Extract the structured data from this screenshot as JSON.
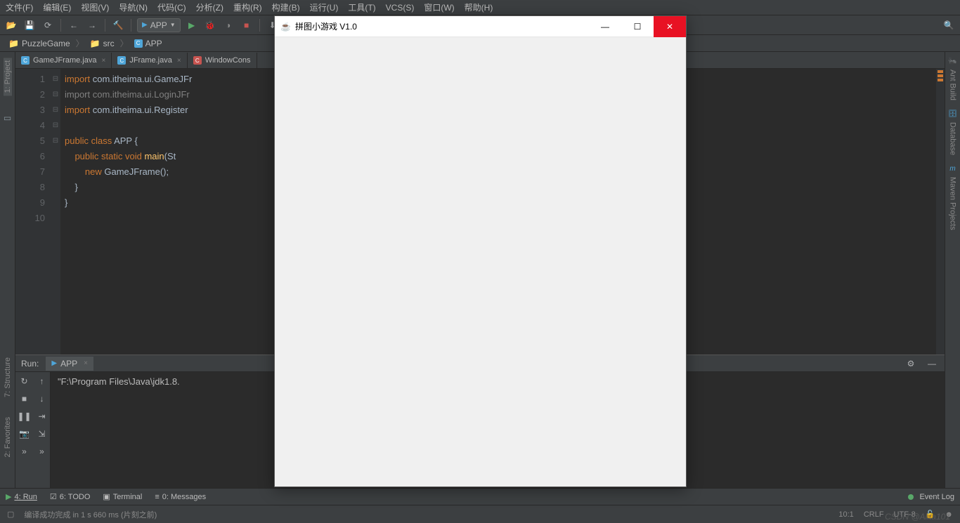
{
  "menu": {
    "file": "文件(F)",
    "edit": "编辑(E)",
    "view": "视图(V)",
    "nav": "导航(N)",
    "code": "代码(C)",
    "analyze": "分析(Z)",
    "refactor": "重构(R)",
    "build": "构建(B)",
    "run": "运行(U)",
    "tools": "工具(T)",
    "vcs": "VCS(S)",
    "window": "窗口(W)",
    "help": "帮助(H)"
  },
  "toolbar": {
    "run_config": "APP"
  },
  "breadcrumb": {
    "p0": "PuzzleGame",
    "p1": "src",
    "p2": "APP"
  },
  "left": {
    "project": "1: Project",
    "structure": "7: Structure",
    "fav": "2: Favorites"
  },
  "right": {
    "ant": "Ant Build",
    "db": "Database",
    "maven": "Maven Projects"
  },
  "tabs": {
    "t0": "GameJFrame.java",
    "t1": "JFrame.java",
    "t2": "WindowCons"
  },
  "code": {
    "l1a": "import ",
    "l1b": "com.itheima.ui.GameJFr",
    "l2a": "import ",
    "l2b": "com.itheima.ui.LoginJFr",
    "l3a": "import ",
    "l3b": "com.itheima.ui.Register",
    "l5a": "public class ",
    "l5b": "APP ",
    "l5c": "{",
    "l6a": "    public static void ",
    "l6b": "main",
    "l6c": "(St",
    "l7a": "        new ",
    "l7b": "GameJFrame",
    "l7c": "();",
    "l8": "    }",
    "l9": "}"
  },
  "run": {
    "label": "Run:",
    "tab": "APP",
    "console": "\"F:\\Program Files\\Java\\jdk1.8."
  },
  "tw": {
    "run": "4: Run",
    "todo": "6: TODO",
    "terminal": "Terminal",
    "messages": "0: Messages",
    "event": "Event Log"
  },
  "status": {
    "msg": "编译成功完成 in 1 s 660 ms (片刻之前)",
    "pos": "10:1",
    "crlf": "CRLF",
    "enc": "UTF-8"
  },
  "app": {
    "title": "拼图小游戏 V1.0"
  },
  "watermark": "CSDN @Alita101"
}
